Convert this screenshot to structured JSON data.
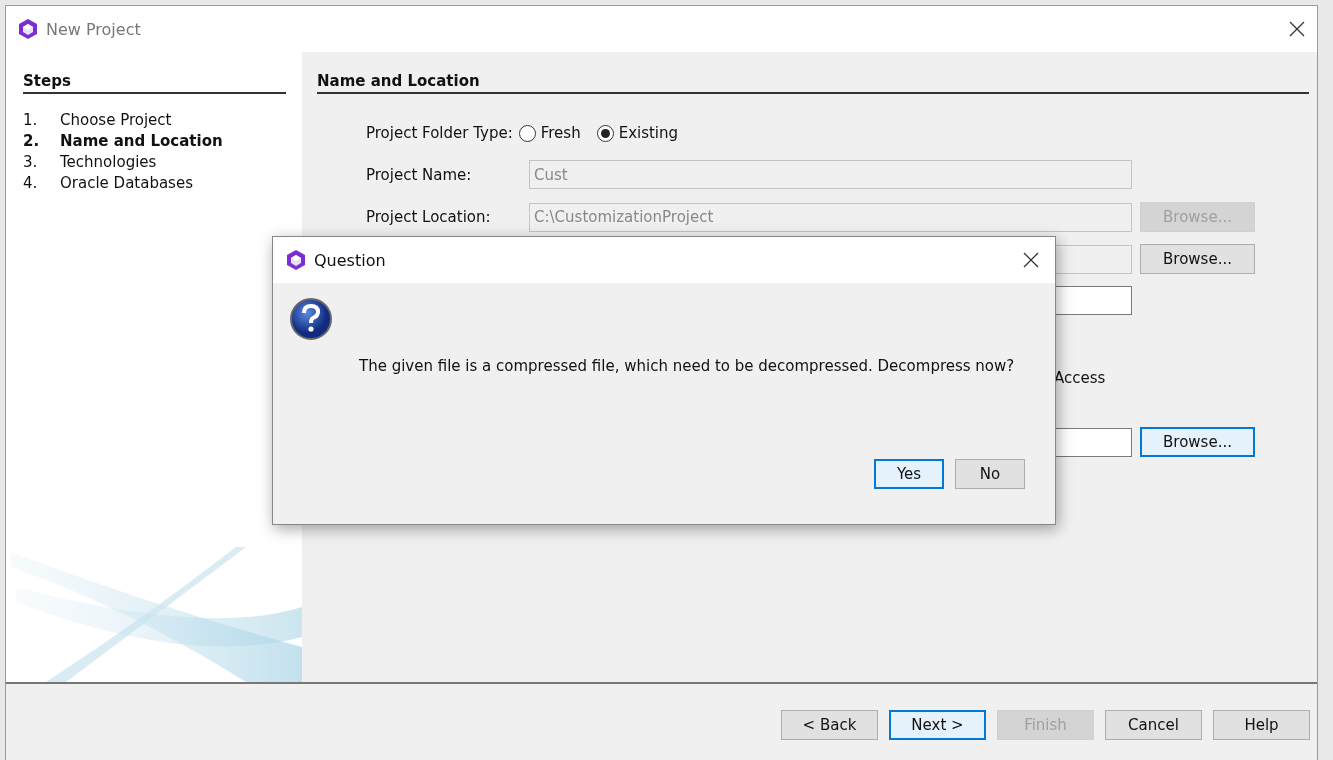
{
  "window": {
    "title": "New Project"
  },
  "steps": {
    "title": "Steps",
    "items": [
      {
        "number": "1.",
        "label": "Choose Project",
        "selected": false
      },
      {
        "number": "2.",
        "label": "Name and Location",
        "selected": true
      },
      {
        "number": "3.",
        "label": "Technologies",
        "selected": false
      },
      {
        "number": "4.",
        "label": "Oracle Databases",
        "selected": false
      }
    ]
  },
  "panel": {
    "title": "Name and Location",
    "folder_type": {
      "label": "Project Folder Type:",
      "options": [
        {
          "label": "Fresh",
          "selected": false
        },
        {
          "label": "Existing",
          "selected": true
        }
      ]
    },
    "rows": [
      {
        "kind": "field",
        "label": "Project Name:",
        "value": "Cust",
        "disabled": true
      },
      {
        "kind": "field",
        "label": "Project Location:",
        "value": "C:\\CustomizationProject",
        "disabled": true,
        "browse": {
          "label": "Browse...",
          "disabled": true,
          "focused": false
        }
      },
      {
        "kind": "field",
        "disabled": true,
        "browse": {
          "label": "Browse...",
          "disabled": false,
          "focused": false
        }
      },
      {
        "kind": "field",
        "disabled": false
      },
      {
        "kind": "text",
        "text": "Access"
      },
      {
        "kind": "field",
        "disabled": false,
        "browse": {
          "label": "Browse...",
          "disabled": false,
          "focused": true
        }
      }
    ]
  },
  "dialog": {
    "title": "Question",
    "message": "The given file is a compressed file, which need to be decompressed. Decompress now?",
    "buttons": [
      {
        "label": "Yes",
        "focused": true
      },
      {
        "label": "No",
        "focused": false
      }
    ]
  },
  "buttons": [
    {
      "label": "< Back",
      "disabled": false,
      "default": false
    },
    {
      "label": "Next >",
      "disabled": false,
      "default": true
    },
    {
      "label": "Finish",
      "disabled": true,
      "default": false
    },
    {
      "label": "Cancel",
      "disabled": false,
      "default": false
    },
    {
      "label": "Help",
      "disabled": false,
      "default": false
    }
  ]
}
